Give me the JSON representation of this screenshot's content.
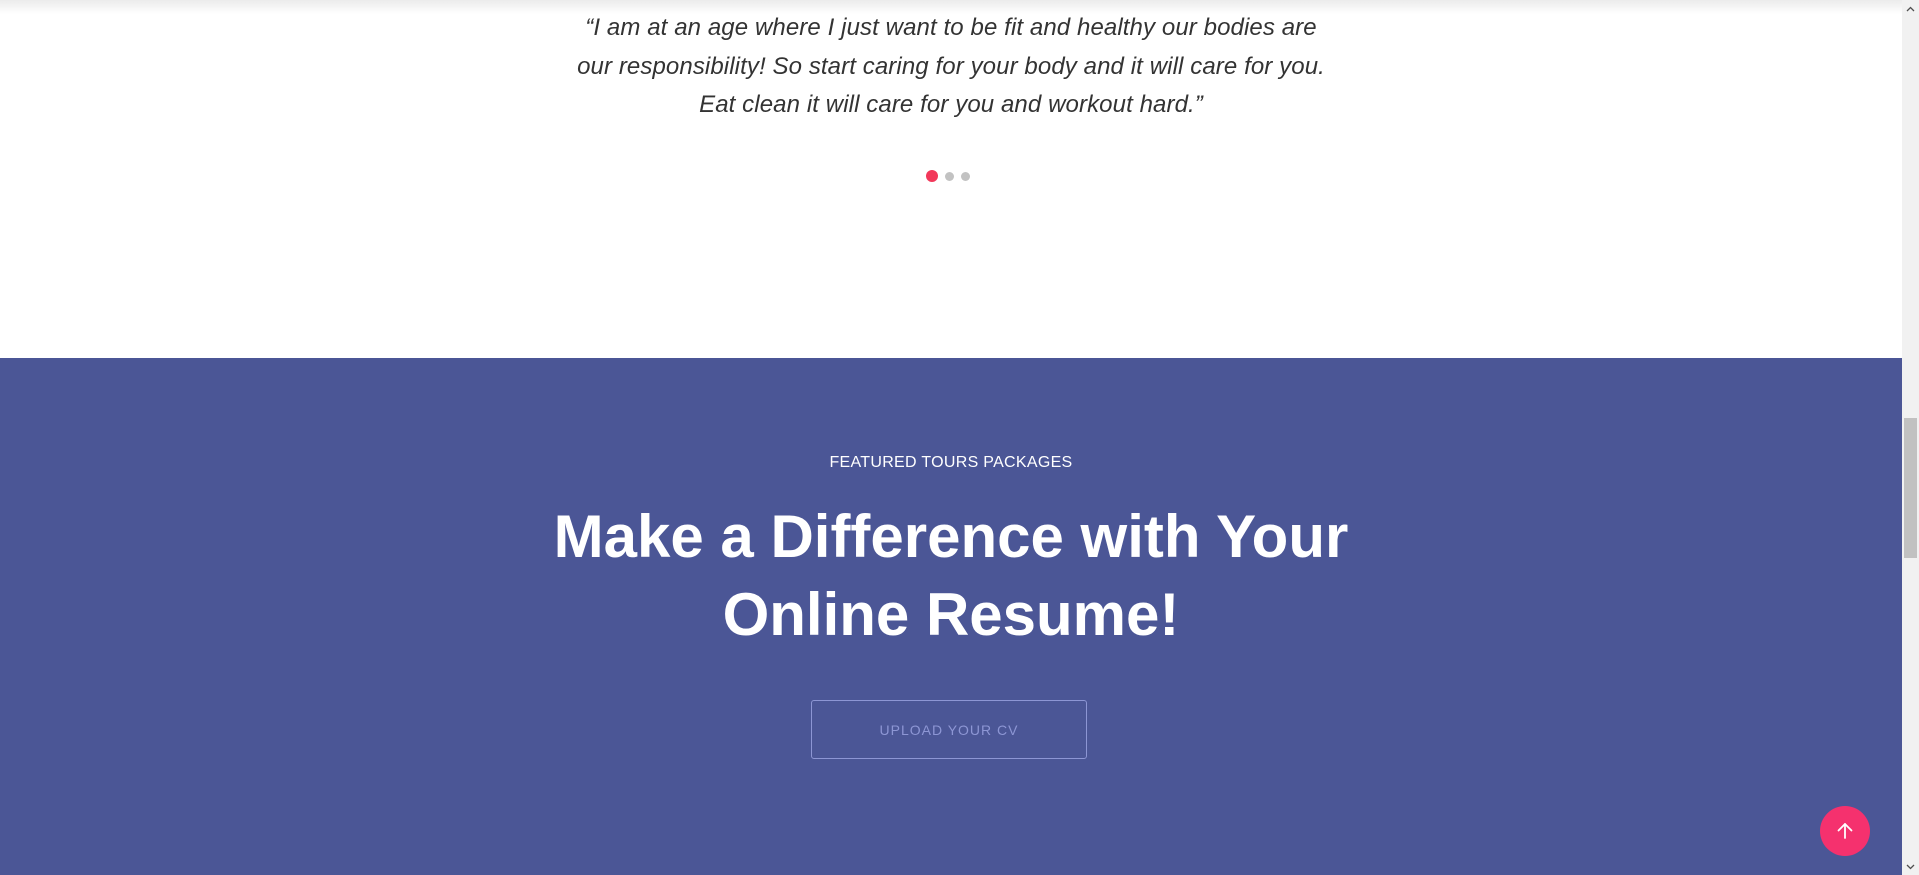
{
  "testimonial": {
    "quote_lines": [
      "“I am at an age where I just want to be fit and healthy our bodies are",
      "our responsibility! So start caring for your body and it will care for you.",
      "Eat clean it will care for you and workout hard.”"
    ],
    "carousel": {
      "slide_count": 3,
      "active_index": 0
    }
  },
  "cta": {
    "eyebrow": "FEATURED TOURS PACKAGES",
    "headline_lines": [
      "Make a Difference with Your",
      "Online Resume!"
    ],
    "button_label": "UPLOAD YOUR CV"
  },
  "floating": {
    "back_to_top_icon": "arrow-up-icon"
  },
  "colors": {
    "accent_dot": "#f2385a",
    "cta_background": "#4b5696",
    "button_outline": "#8d96d4",
    "back_to_top": "#f5316e"
  }
}
